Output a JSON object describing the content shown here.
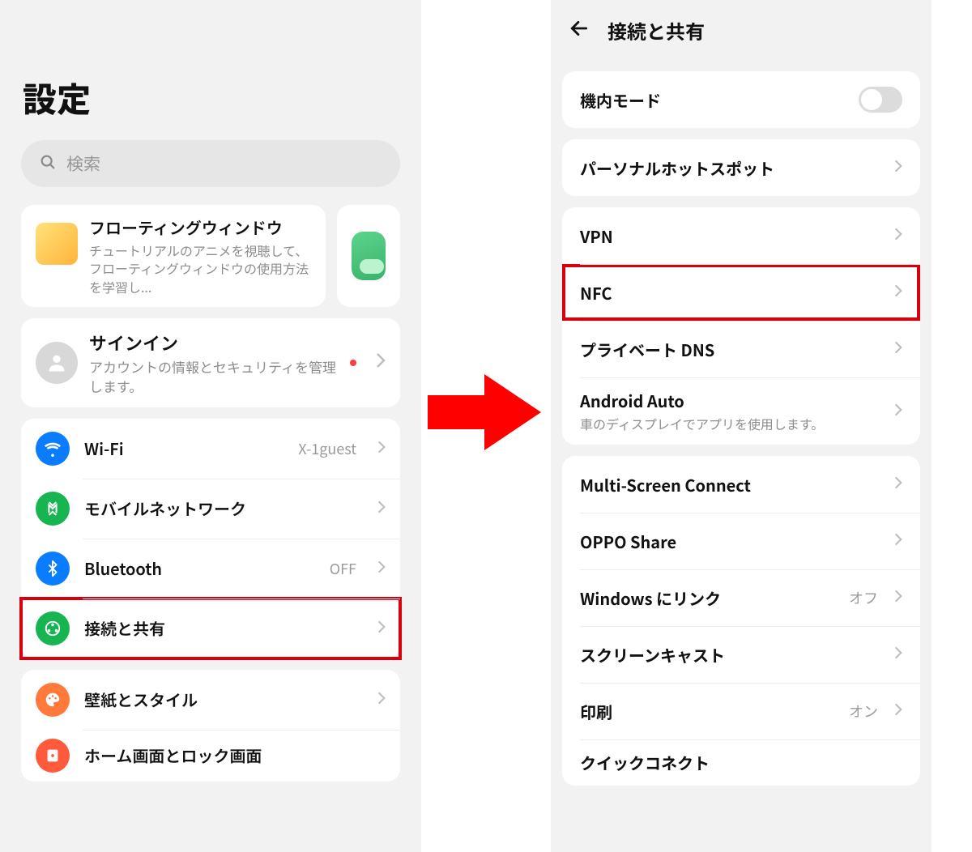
{
  "left": {
    "title": "設定",
    "search_placeholder": "検索",
    "promo": {
      "title": "フローティングウィンドウ",
      "body": "チュートリアルのアニメを視聴して、フローティングウィンドウの使用方法を学習し..."
    },
    "signin": {
      "title": "サインイン",
      "body": "アカウントの情報とセキュリティを管理します。"
    },
    "rows": {
      "wifi": {
        "label": "Wi-Fi",
        "value": "X-1guest"
      },
      "mobile": {
        "label": "モバイルネットワーク"
      },
      "bluetooth": {
        "label": "Bluetooth",
        "value": "OFF"
      },
      "share": {
        "label": "接続と共有"
      },
      "wallpaper": {
        "label": "壁紙とスタイル"
      },
      "home": {
        "label": "ホーム画面とロック画面"
      }
    }
  },
  "right": {
    "title": "接続と共有",
    "rows": {
      "airplane": {
        "label": "機内モード"
      },
      "hotspot": {
        "label": "パーソナルホットスポット"
      },
      "vpn": {
        "label": "VPN"
      },
      "nfc": {
        "label": "NFC"
      },
      "dns": {
        "label": "プライベート DNS"
      },
      "aauto": {
        "label": "Android Auto",
        "sub": "車のディスプレイでアプリを使用します。"
      },
      "msc": {
        "label": "Multi-Screen Connect"
      },
      "oppo": {
        "label": "OPPO Share"
      },
      "winlink": {
        "label": "Windows にリンク",
        "value": "オフ"
      },
      "cast": {
        "label": "スクリーンキャスト"
      },
      "print": {
        "label": "印刷",
        "value": "オン"
      },
      "quick": {
        "label": "クイックコネクト"
      }
    }
  }
}
